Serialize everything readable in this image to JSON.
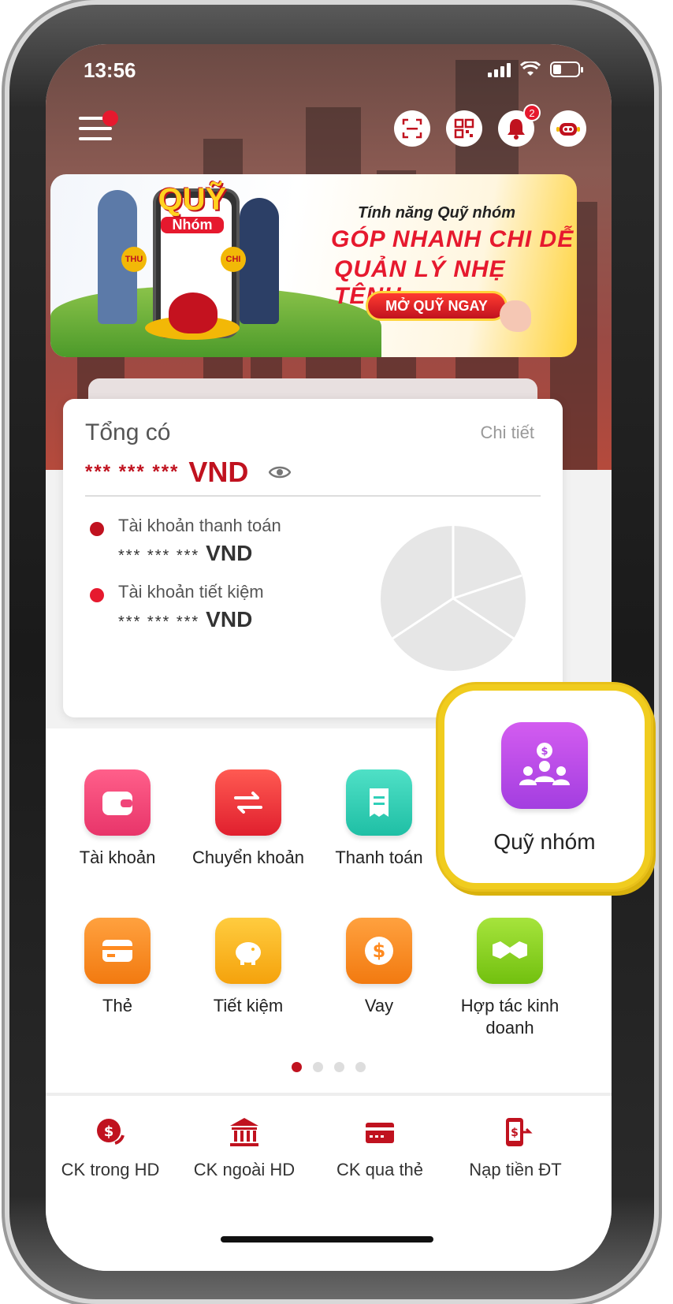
{
  "status_bar": {
    "time": "13:56"
  },
  "header": {
    "notification_count": "2"
  },
  "banner": {
    "logo_title": "QUỸ",
    "logo_sub": "Nhóm",
    "tag_left": "THU",
    "tag_right": "CHI",
    "subtitle": "Tính năng Quỹ nhóm",
    "headline_1": "GÓP NHANH CHI DỄ",
    "headline_2": "QUẢN LÝ NHẸ TÊNH",
    "cta": "MỞ QUỸ NGAY"
  },
  "balance_card": {
    "title": "Tổng có",
    "detail_link": "Chi tiết",
    "total_masked": "*** *** ***",
    "currency": "VND",
    "accounts": [
      {
        "label": "Tài khoản thanh toán",
        "masked": "*** *** ***",
        "currency": "VND",
        "color": "#c0121f"
      },
      {
        "label": "Tài khoản tiết kiệm",
        "masked": "*** *** ***",
        "currency": "VND",
        "color": "#e6192e"
      }
    ]
  },
  "quick_actions": [
    {
      "label": "Tài khoản",
      "icon": "wallet-icon",
      "color": "#f0457a"
    },
    {
      "label": "Chuyển khoản",
      "icon": "transfer-arrows-icon",
      "color": "#f0343b"
    },
    {
      "label": "Thanh toán",
      "icon": "receipt-icon",
      "color": "#2fcfb8"
    },
    {
      "label": "Thẻ",
      "icon": "card-icon",
      "color": "#ff8a1f"
    },
    {
      "label": "Tiết kiệm",
      "icon": "piggy-bank-icon",
      "color": "#ffb81f"
    },
    {
      "label": "Vay",
      "icon": "dollar-coin-icon",
      "color": "#ff8a1f"
    },
    {
      "label": "Hợp tác kinh doanh",
      "icon": "handshake-icon",
      "color": "#8fd42a"
    }
  ],
  "highlight": {
    "label": "Quỹ nhóm",
    "icon": "group-fund-icon"
  },
  "pagination": {
    "total": 4,
    "active": 0
  },
  "bottom_bar": [
    {
      "label": "CK trong HD",
      "icon": "coin-transfer-icon"
    },
    {
      "label": "CK ngoài HD",
      "icon": "bank-icon"
    },
    {
      "label": "CK qua thẻ",
      "icon": "card-transfer-icon"
    },
    {
      "label": "Nạp tiền ĐT",
      "icon": "phone-topup-icon"
    }
  ]
}
